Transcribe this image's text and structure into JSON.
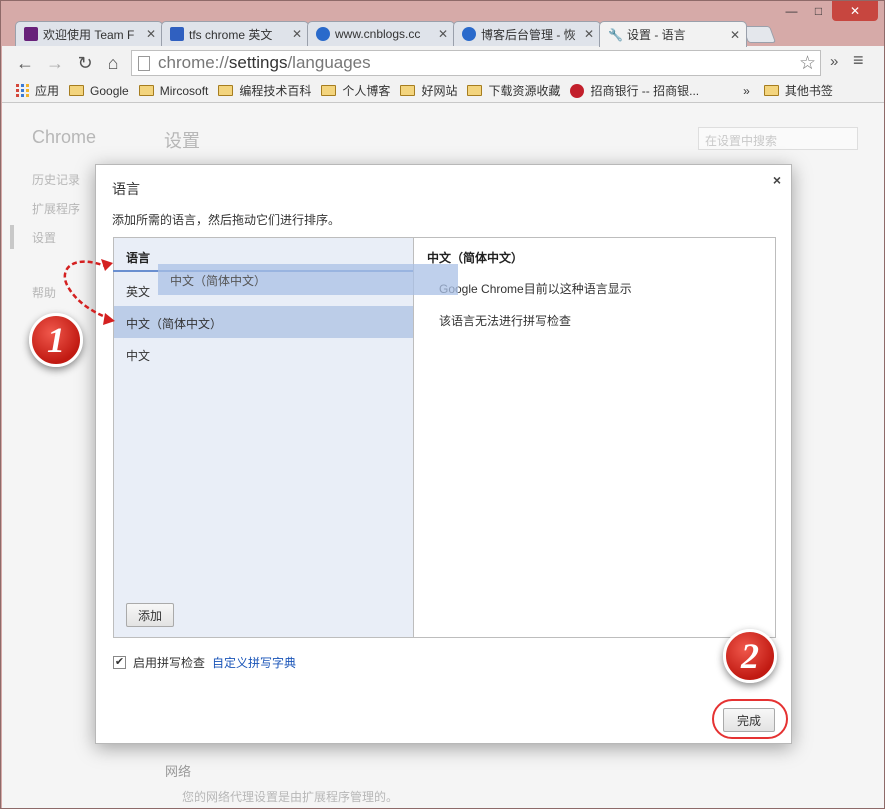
{
  "tabs": [
    {
      "label": "欢迎使用 Team F",
      "favicon_color": "#68217a"
    },
    {
      "label": "tfs chrome 英文",
      "favicon_color": "#3060c0"
    },
    {
      "label": "www.cnblogs.cc",
      "favicon_color": "#2a6acb"
    },
    {
      "label": "博客后台管理 - 恢",
      "favicon_color": "#2a6acb"
    },
    {
      "label": "设置 - 语言",
      "favicon_icon": "wrench-icon"
    }
  ],
  "toolbar": {
    "url_scheme": "chrome://",
    "url_host": "settings",
    "url_path": "/languages",
    "overflow": "»",
    "menu": "≡"
  },
  "bookmarks": [
    {
      "label": "应用",
      "icon": "apps-icon"
    },
    {
      "label": "Google",
      "icon": "folder-icon"
    },
    {
      "label": "Mircosoft",
      "icon": "folder-icon"
    },
    {
      "label": "编程技术百科",
      "icon": "folder-icon"
    },
    {
      "label": "个人博客",
      "icon": "folder-icon"
    },
    {
      "label": "好网站",
      "icon": "folder-icon"
    },
    {
      "label": "下载资源收藏",
      "icon": "folder-icon"
    },
    {
      "label": "招商银行 -- 招商银...",
      "icon": "cmb-icon"
    }
  ],
  "bookmarks_overflow": "»",
  "other_bookmarks": "其他书签",
  "settings_page": {
    "brand": "Chrome",
    "title": "设置",
    "search_placeholder": "在设置中搜索",
    "nav": [
      "历史记录",
      "扩展程序",
      "设置",
      "帮助"
    ],
    "network_heading": "网络",
    "network_note": "您的网络代理设置是由扩展程序管理的。"
  },
  "dialog": {
    "title": "语言",
    "close": "×",
    "description": "添加所需的语言，然后拖动它们进行排序。",
    "list_header": "语言",
    "languages": [
      "英文",
      "中文（简体中文）",
      "中文"
    ],
    "drag_ghost": "中文（简体中文）",
    "add_button": "添加",
    "detail_title": "中文（简体中文）",
    "detail_lines": [
      "Google Chrome目前以这种语言显示",
      "该语言无法进行拼写检查"
    ],
    "spellcheck_label": "启用拼写检查",
    "spellcheck_checked": true,
    "spellcheck_link": "自定义拼写字典",
    "done_button": "完成"
  },
  "annotations": {
    "step1": "1",
    "step2": "2"
  },
  "window_buttons": {
    "minimize": "—",
    "maximize": "□",
    "close": "✕"
  }
}
